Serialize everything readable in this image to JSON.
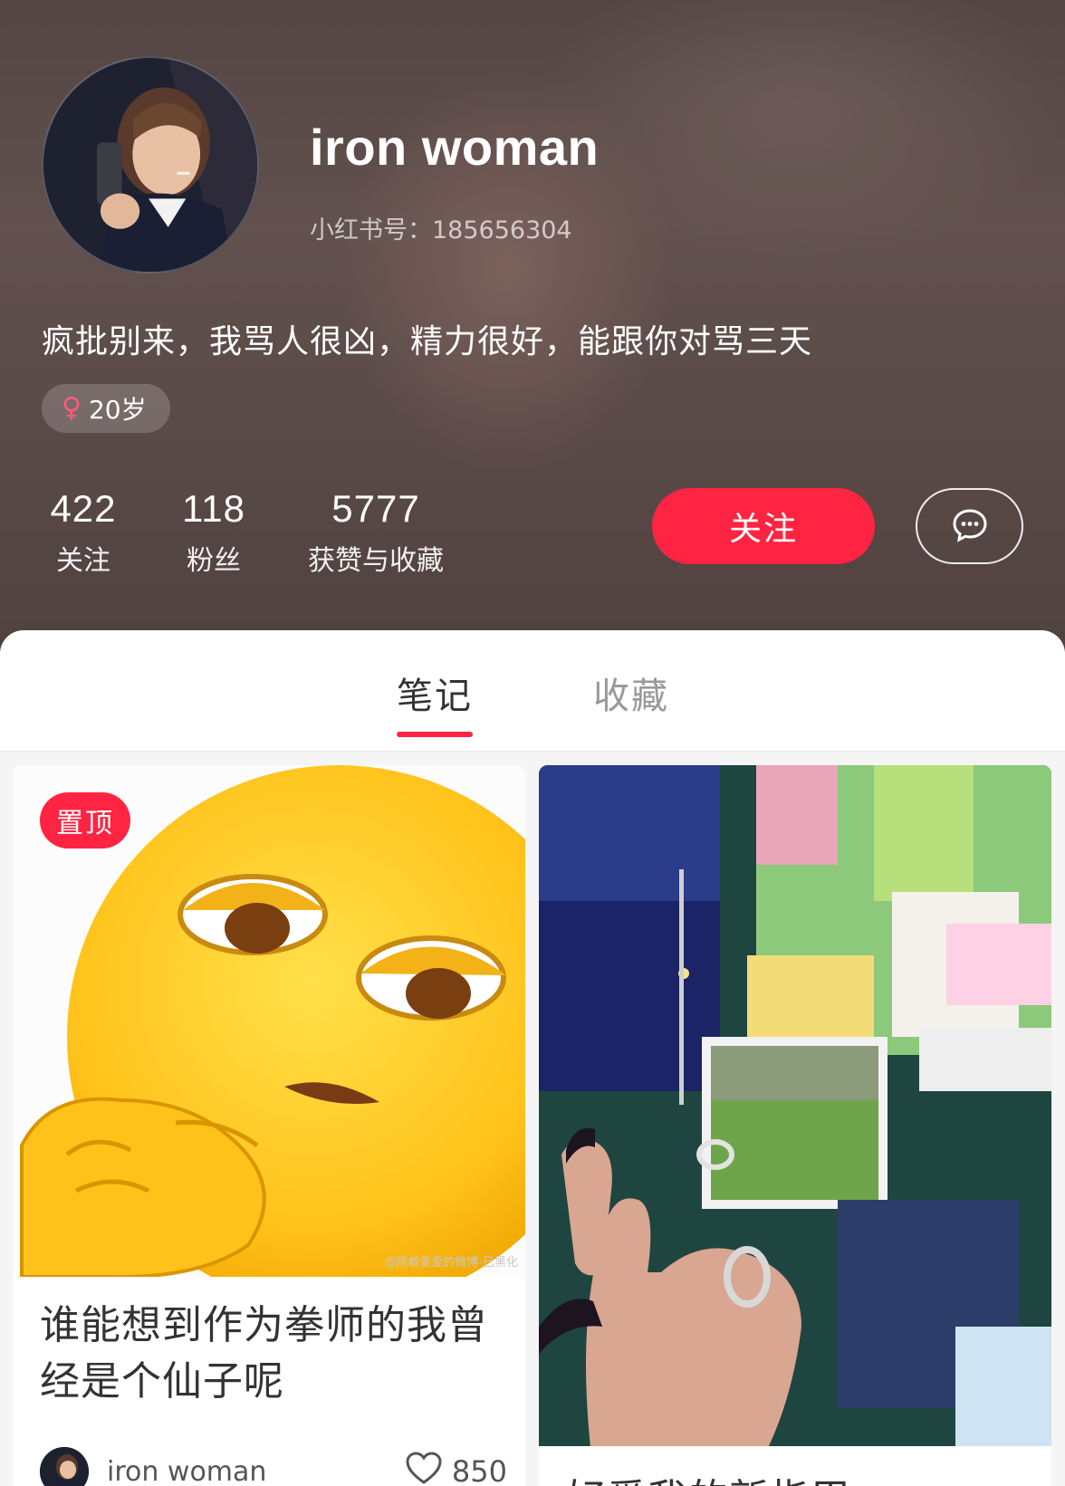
{
  "profile": {
    "username": "iron woman",
    "user_id": "小红书号：185656304",
    "bio": "疯批别来，我骂人很凶，精力很好，能跟你对骂三天",
    "gender_icon": "♀",
    "age_tag": "20岁"
  },
  "stats": [
    {
      "value": "422",
      "label": "关注"
    },
    {
      "value": "118",
      "label": "粉丝"
    },
    {
      "value": "5777",
      "label": "获赞与收藏"
    }
  ],
  "actions": {
    "follow_label": "关注",
    "message_icon": "chat-bubble-icon"
  },
  "tabs": [
    {
      "label": "笔记",
      "active": true
    },
    {
      "label": "收藏",
      "active": false
    }
  ],
  "notes": [
    {
      "pinned_label": "置顶",
      "title": "谁能想到作为拳师的我曾经是个仙子呢",
      "author": "iron woman",
      "likes": "850",
      "watermark": "@随着爱爱的微博-已黑化"
    },
    {
      "title": "好爱我的新指甲"
    }
  ],
  "colors": {
    "accent": "#ff2442",
    "header_bg": "#665552"
  }
}
